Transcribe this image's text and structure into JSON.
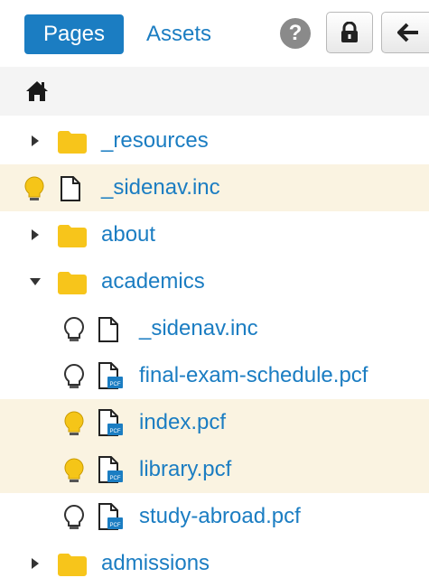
{
  "toolbar": {
    "tabs": [
      {
        "label": "Pages",
        "active": true
      },
      {
        "label": "Assets",
        "active": false
      }
    ],
    "help_icon": "question-circle-icon",
    "lock_icon": "lock-icon",
    "back_icon": "arrow-left-icon"
  },
  "home_icon": "home-icon",
  "tree": [
    {
      "label": "_resources",
      "type": "folder",
      "expanded": false,
      "level": 0
    },
    {
      "label": "_sidenav.inc",
      "type": "file",
      "bulb": "on",
      "level": 0,
      "highlight": true
    },
    {
      "label": "about",
      "type": "folder",
      "expanded": false,
      "level": 0
    },
    {
      "label": "academics",
      "type": "folder",
      "expanded": true,
      "level": 0
    },
    {
      "label": "_sidenav.inc",
      "type": "file",
      "bulb": "off",
      "level": 1
    },
    {
      "label": "final-exam-schedule.pcf",
      "type": "pcf",
      "bulb": "off",
      "level": 1
    },
    {
      "label": "index.pcf",
      "type": "pcf",
      "bulb": "on",
      "level": 1,
      "highlight": true
    },
    {
      "label": "library.pcf",
      "type": "pcf",
      "bulb": "on",
      "level": 1,
      "highlight": true
    },
    {
      "label": "study-abroad.pcf",
      "type": "pcf",
      "bulb": "off",
      "level": 1
    },
    {
      "label": "admissions",
      "type": "folder",
      "expanded": false,
      "level": 0
    }
  ],
  "colors": {
    "accent": "#1b7dc2",
    "folder": "#f7c51b",
    "bulb_on": "#f5c518",
    "highlight_row": "#faf3e1"
  }
}
